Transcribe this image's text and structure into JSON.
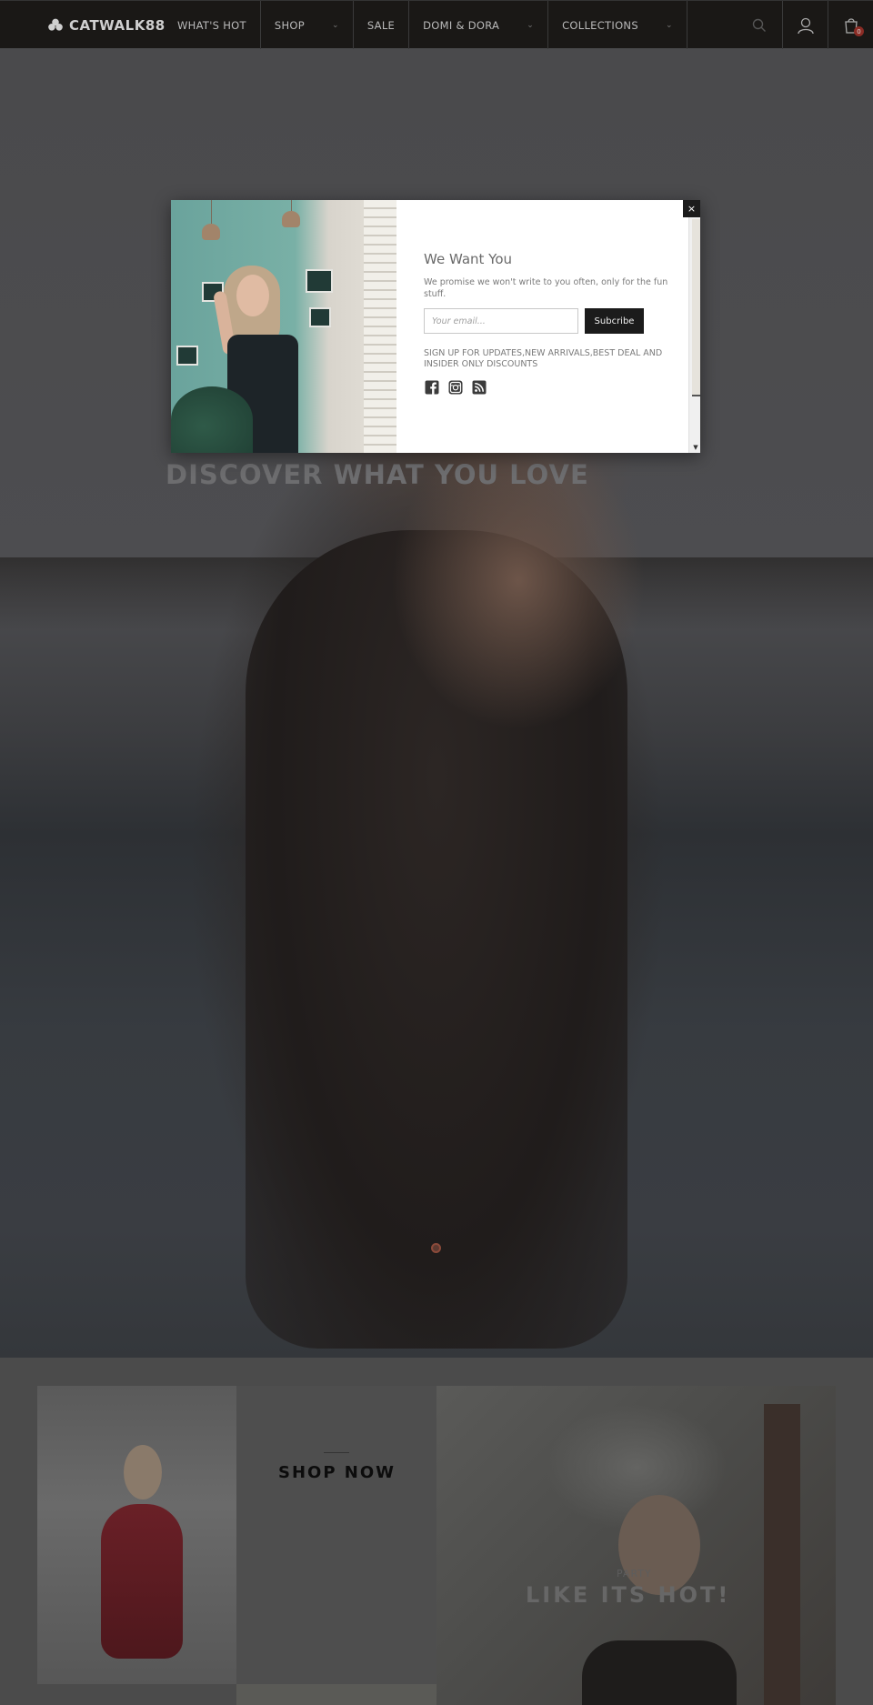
{
  "header": {
    "logo": "CATWALK88",
    "nav": [
      {
        "label": "WHAT'S HOT",
        "has_dropdown": false
      },
      {
        "label": "SHOP",
        "has_dropdown": true
      },
      {
        "label": "SALE",
        "has_dropdown": false
      },
      {
        "label": "DOMI & DORA",
        "has_dropdown": true
      },
      {
        "label": "COLLECTIONS",
        "has_dropdown": true
      }
    ],
    "icons": [
      "search-icon",
      "user-icon",
      "cart-icon"
    ],
    "cart_count": "0"
  },
  "hero": {
    "title": "DISCOVER WHAT YOU LOVE"
  },
  "promo": {
    "shop_now": "SHOP NOW",
    "party_label": "PARTY",
    "party_title": "LIKE ITS HOT!"
  },
  "modal": {
    "title": "We Want You",
    "description": "We promise we won't write to you often, only for the fun stuff.",
    "email_placeholder": "Your email...",
    "subscribe_label": "Subcribe",
    "signup_text": "SIGN UP FOR UPDATES,NEW ARRIVALS,BEST DEAL AND INSIDER ONLY DISCOUNTS",
    "socials": [
      "facebook-icon",
      "instagram-icon",
      "rss-icon"
    ],
    "close_label": "×"
  },
  "colors": {
    "header_bg": "#1a1816",
    "accent": "#8b2c25",
    "button_dark": "#1b1b1b"
  }
}
